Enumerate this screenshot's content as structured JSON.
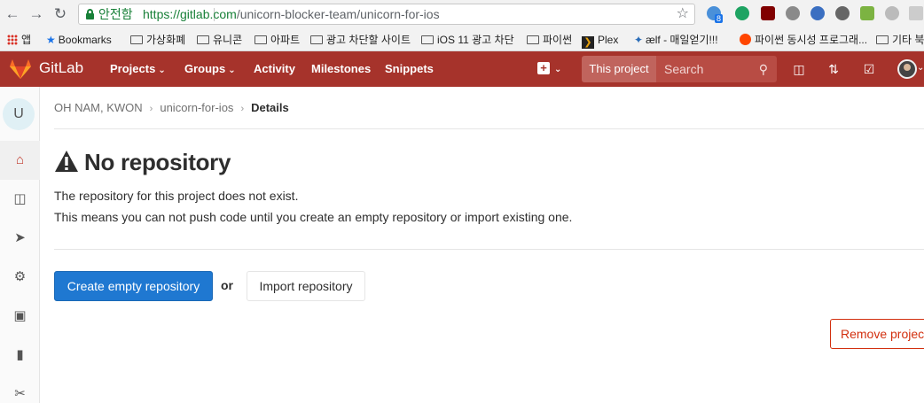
{
  "browser": {
    "secure_label": "안전함",
    "url_host": "https://gitlab.com",
    "url_path": "/unicorn-blocker-team/unicorn-for-ios",
    "ext_badge": "8",
    "bookmarks": [
      {
        "label": "앱",
        "icon": "apps-grid-icon"
      },
      {
        "label": "Bookmarks",
        "icon": "star-icon"
      },
      {
        "label": "가상화폐",
        "icon": "folder-icon"
      },
      {
        "label": "유니콘",
        "icon": "folder-icon"
      },
      {
        "label": "아파트",
        "icon": "folder-icon"
      },
      {
        "label": "광고 차단할 사이트",
        "icon": "folder-icon"
      },
      {
        "label": "iOS 11 광고 차단",
        "icon": "folder-icon"
      },
      {
        "label": "파이썬",
        "icon": "folder-icon"
      },
      {
        "label": "Plex",
        "icon": "plex-icon"
      },
      {
        "label": "ælf - 매일얻기!!!",
        "icon": "aelf-icon"
      },
      {
        "label": "파이썬 동시성 프로그래...",
        "icon": "reddit-icon"
      },
      {
        "label": "기타 북",
        "icon": "folder-icon"
      }
    ]
  },
  "header": {
    "brand": "GitLab",
    "nav": [
      {
        "label": "Projects",
        "has_caret": true
      },
      {
        "label": "Groups",
        "has_caret": true
      },
      {
        "label": "Activity",
        "has_caret": false
      },
      {
        "label": "Milestones",
        "has_caret": false
      },
      {
        "label": "Snippets",
        "has_caret": false
      }
    ],
    "scope": "This project",
    "search_placeholder": "Search",
    "colors": {
      "header_bg": "#a6332b",
      "primary": "#1f78d1",
      "danger": "#d22f0e"
    }
  },
  "sidebar": {
    "project_initial": "U",
    "items": [
      {
        "icon": "home-icon",
        "active": true
      },
      {
        "icon": "issues-icon",
        "active": false
      },
      {
        "icon": "rocket-icon",
        "active": false
      },
      {
        "icon": "ci-cd-icon",
        "active": false
      },
      {
        "icon": "monitor-icon",
        "active": false
      },
      {
        "icon": "wiki-book-icon",
        "active": false
      },
      {
        "icon": "snippets-scissors-icon",
        "active": false
      }
    ]
  },
  "breadcrumbs": {
    "items": [
      "OH NAM, KWON",
      "unicorn-for-ios",
      "Details"
    ]
  },
  "content": {
    "title": "No repository",
    "line1": "The repository for this project does not exist.",
    "line2": "This means you can not push code until you create an empty repository or import existing one.",
    "create_button": "Create empty repository",
    "or": "or",
    "import_button": "Import repository",
    "remove_button": "Remove project"
  }
}
